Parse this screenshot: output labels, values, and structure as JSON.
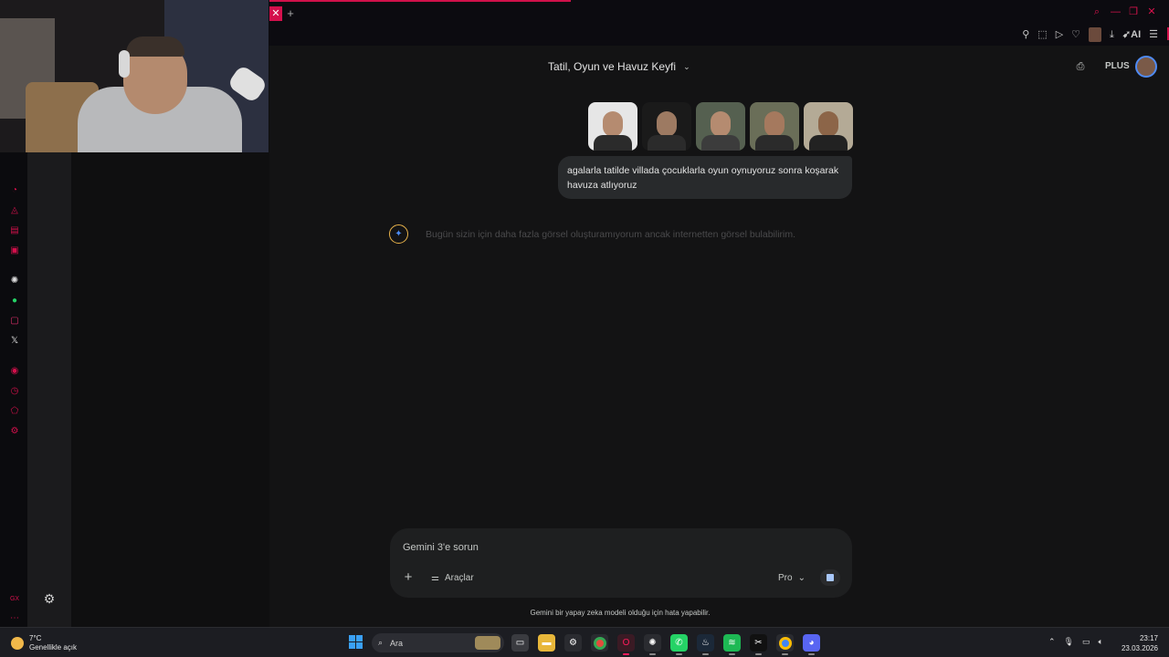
{
  "browser": {
    "tab_close": "✕",
    "tab_new": "+",
    "ai_label": "AI"
  },
  "header": {
    "conversation_title": "Tatil, Oyun ve Havuz Keyfi",
    "plan_badge": "PLUS"
  },
  "chat": {
    "user_message": "agalarla tatilde villada çocuklarla oyun oynuyoruz sonra koşarak havuza atlıyoruz",
    "assistant_message": "Bugün sizin için daha fazla görsel oluşturamıyorum ancak internetten görsel bulabilirim."
  },
  "composer": {
    "placeholder": "Gemini 3'e sorun",
    "tools_label": "Araçlar",
    "model_label": "Pro"
  },
  "footer": {
    "disclaimer": "Gemini bir yapay zeka modeli olduğu için hata yapabilir."
  },
  "taskbar": {
    "weather_temp": "7°C",
    "weather_desc": "Genellikle açık",
    "search_label": "Ara",
    "time": "23:17",
    "date": "23.03.2026"
  },
  "colors": {
    "accent": "#d4104c",
    "page_bg": "#131314",
    "bubble_bg": "#282a2c",
    "composer_bg": "#1e1f20"
  },
  "icons": {
    "sidebar": [
      "opera-icon",
      "bag-icon",
      "wallet-icon",
      "player-icon",
      "chatgpt-icon",
      "whatsapp-icon",
      "instagram-icon",
      "x-icon",
      "record-icon",
      "history-icon",
      "extensions-icon",
      "settings-icon"
    ]
  }
}
